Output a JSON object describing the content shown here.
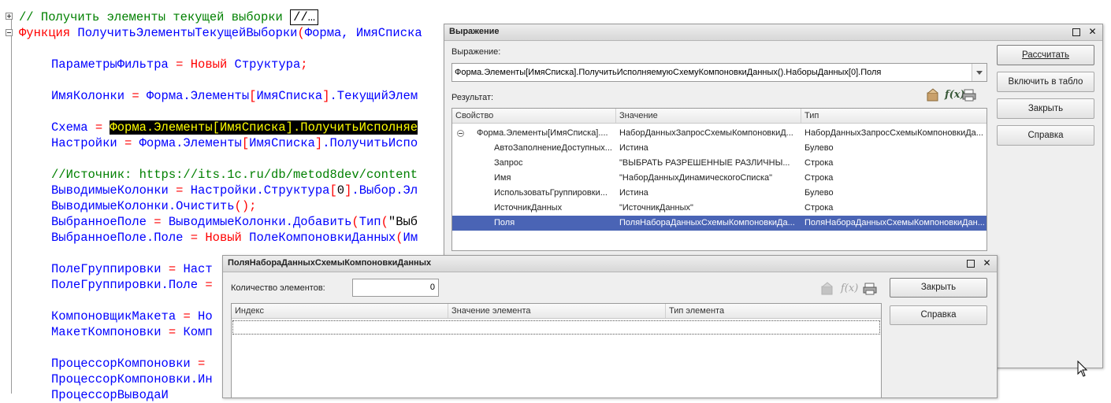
{
  "code": {
    "l0_comment": "// Получить элементы текущей выборки",
    "l0_box": "//…",
    "l1_kw": "Функция",
    "l1_name": " ПолучитьЭлементыТекущейВыборки",
    "l1_paren": "(",
    "l1_rest": "Форма, ИмяСписка",
    "l3_a": "ПараметрыФильтра",
    "l3_eq": " = ",
    "l3_kw": "Новый",
    "l3_b": " Структура",
    "l3_end": ";",
    "l5_a": "ИмяКолонки",
    "l5_eq": " = ",
    "l5_b": "Форма.Элементы",
    "l5_c": "[",
    "l5_d": "ИмяСписка",
    "l5_e": "]",
    "l5_f": ".ТекущийЭлем",
    "l7_a": "Схема",
    "l7_eq": " = ",
    "l7_hl": "Форма.Элементы[ИмяСписка].ПолучитьИсполняе",
    "l8_a": "Настройки",
    "l8_eq": " = ",
    "l8_b": "Форма.Элементы",
    "l8_c": "[",
    "l8_d": "ИмяСписка",
    "l8_e": "]",
    "l8_f": ".ПолучитьИспо",
    "l10": "//Источник: https://its.1c.ru/db/metod8dev/content",
    "l11_a": "ВыводимыеКолонки",
    "l11_eq": " = ",
    "l11_b": "Настройки.Структура",
    "l11_c": "[",
    "l11_d": "0",
    "l11_e": "]",
    "l11_f": ".Выбор.Эл",
    "l12_a": "ВыводимыеКолонки.Очистить",
    "l12_b": "();",
    "l13_a": "ВыбранноеПоле",
    "l13_eq": " = ",
    "l13_b": "ВыводимыеКолонки.Добавить",
    "l13_c": "(",
    "l13_d": "Тип",
    "l13_e": "(",
    "l13_f": "\"Выб",
    "l14_a": "ВыбранноеПоле.Поле",
    "l14_eq": " = ",
    "l14_kw": "Новый",
    "l14_b": " ПолеКомпоновкиДанных",
    "l14_c": "(",
    "l14_d": "Им",
    "l16_a": "ПолеГруппировки",
    "l16_eq": " = ",
    "l16_b": "Наст",
    "l17_a": "ПолеГруппировки.Поле",
    "l17_eq": " = ",
    "l19_a": "КомпоновщикМакета",
    "l19_eq": " = ",
    "l19_b": "Но",
    "l20_a": "МакетКомпоновки",
    "l20_eq": " = ",
    "l20_b": "Комп",
    "l22_a": "ПроцессорКомпоновки",
    "l22_eq": " = ",
    "l23_a": "ПроцессорКомпоновки.Ин",
    "l24_a": "ПроцессорВыводаИ"
  },
  "expr_window": {
    "title": "Выражение",
    "expr_label": "Выражение:",
    "expr_value": "Форма.Элементы[ИмяСписка].ПолучитьИсполняемуюСхемуКомпоновкиДанных().НаборыДанных[0].Поля",
    "result_label": "Результат:",
    "columns": [
      "Свойство",
      "Значение",
      "Тип"
    ],
    "rows": [
      {
        "prop": "Форма.Элементы[ИмяСписка]....",
        "val": "НаборДанныхЗапросСхемыКомпоновкиД...",
        "type": "НаборДанныхЗапросСхемыКомпоновкиДа..."
      },
      {
        "prop": "АвтоЗаполнениеДоступных...",
        "val": "Истина",
        "type": "Булево"
      },
      {
        "prop": "Запрос",
        "val": "\"ВЫБРАТЬ РАЗРЕШЕННЫЕ РАЗЛИЧНЫ...",
        "type": "Строка"
      },
      {
        "prop": "Имя",
        "val": "\"НаборДанныхДинамическогоСписка\"",
        "type": "Строка"
      },
      {
        "prop": "ИспользоватьГруппировки...",
        "val": "Истина",
        "type": "Булево"
      },
      {
        "prop": "ИсточникДанных",
        "val": "\"ИсточникДанных\"",
        "type": "Строка"
      },
      {
        "prop": "Поля",
        "val": "ПоляНабораДанныхСхемыКомпоновкиДа...",
        "type": "ПоляНабораДанныхСхемыКомпоновкиДан..."
      }
    ],
    "buttons": {
      "calc": "Рассчитать",
      "add": "Включить в табло",
      "close": "Закрыть",
      "help": "Справка"
    },
    "icons": [
      "edit-icon",
      "function-icon",
      "print-icon"
    ]
  },
  "fields_window": {
    "title": "ПоляНабораДанныхСхемыКомпоновкиДанных",
    "count_label": "Количество элементов:",
    "count_value": "0",
    "columns": [
      "Индекс",
      "Значение элемента",
      "Тип элемента"
    ],
    "buttons": {
      "close": "Закрыть",
      "help": "Справка"
    }
  },
  "window_controls": {
    "maximize": "□",
    "close": "✕"
  }
}
